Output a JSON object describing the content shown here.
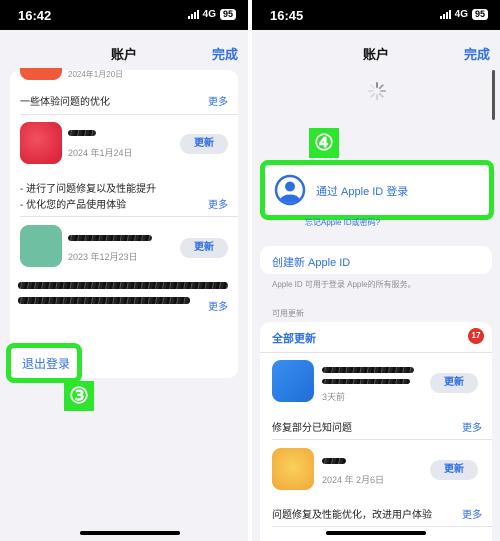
{
  "left": {
    "time": "16:42",
    "network": "4G",
    "battery": "95",
    "title": "账户",
    "done": "完成",
    "date_partial": "2024年1月20日",
    "item0_note": "一些体验问题的优化",
    "more": "更多",
    "item1": {
      "date": "2024 年1月24日",
      "button": "更新",
      "note1": "- 进行了问题修复以及性能提升",
      "note2": "- 优化您的产品使用体验"
    },
    "item2": {
      "date": "2023 年12月23日",
      "button": "更新"
    },
    "logout": "退出登录",
    "step_label": "③",
    "colors": {
      "accent": "#2f6fe6",
      "highlight": "#2ee52e"
    }
  },
  "right": {
    "time": "16:45",
    "network": "4G",
    "battery": "95",
    "title": "账户",
    "done": "完成",
    "step_label": "④",
    "signin": "通过 Apple ID 登录",
    "forgot": "忘记Apple ID或密码?",
    "create": "创建新 Apple ID",
    "create_desc": "Apple ID 可用于登录 Apple的所有服务。",
    "section": "可用更新",
    "update_all": "全部更新",
    "count": "17",
    "app1": {
      "date": "3天前",
      "button": "更新",
      "note": "修复部分已知问题"
    },
    "app2": {
      "date": "2024 年 2月6日",
      "button": "更新",
      "note": "问题修复及性能优化，改进用户体验"
    },
    "more": "更多"
  }
}
